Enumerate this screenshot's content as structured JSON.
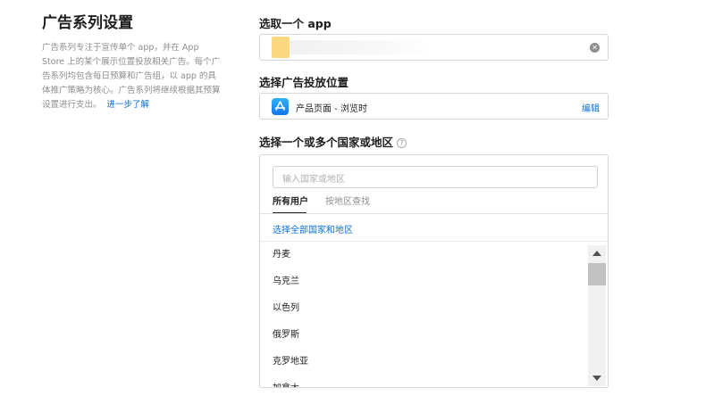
{
  "left": {
    "title": "广告系列设置",
    "description": "广告系列专注于宣传单个 app，并在 App Store 上的某个展示位置投放相关广告。每个广告系列均包含每日预算和广告组，以 app 的具体推广策略为核心。广告系列将继续根据其预算设置进行支出。",
    "learn_more": "进一步了解"
  },
  "app_select": {
    "label": "选取一个 app"
  },
  "placement": {
    "label": "选择广告投放位置",
    "value": "产品页面 - 浏览时",
    "edit_label": "编辑"
  },
  "countries": {
    "label": "选择一个或多个国家或地区",
    "help_icon": "?",
    "search_placeholder": "输入国家或地区",
    "tabs": [
      "所有用户",
      "按地区查找"
    ],
    "select_all": "选择全部国家和地区",
    "items": [
      "丹麦",
      "乌克兰",
      "以色列",
      "俄罗斯",
      "克罗地亚",
      "加拿大"
    ]
  },
  "colors": {
    "accent": "#0a6fd6",
    "app_store_icon": "#1377ee"
  }
}
